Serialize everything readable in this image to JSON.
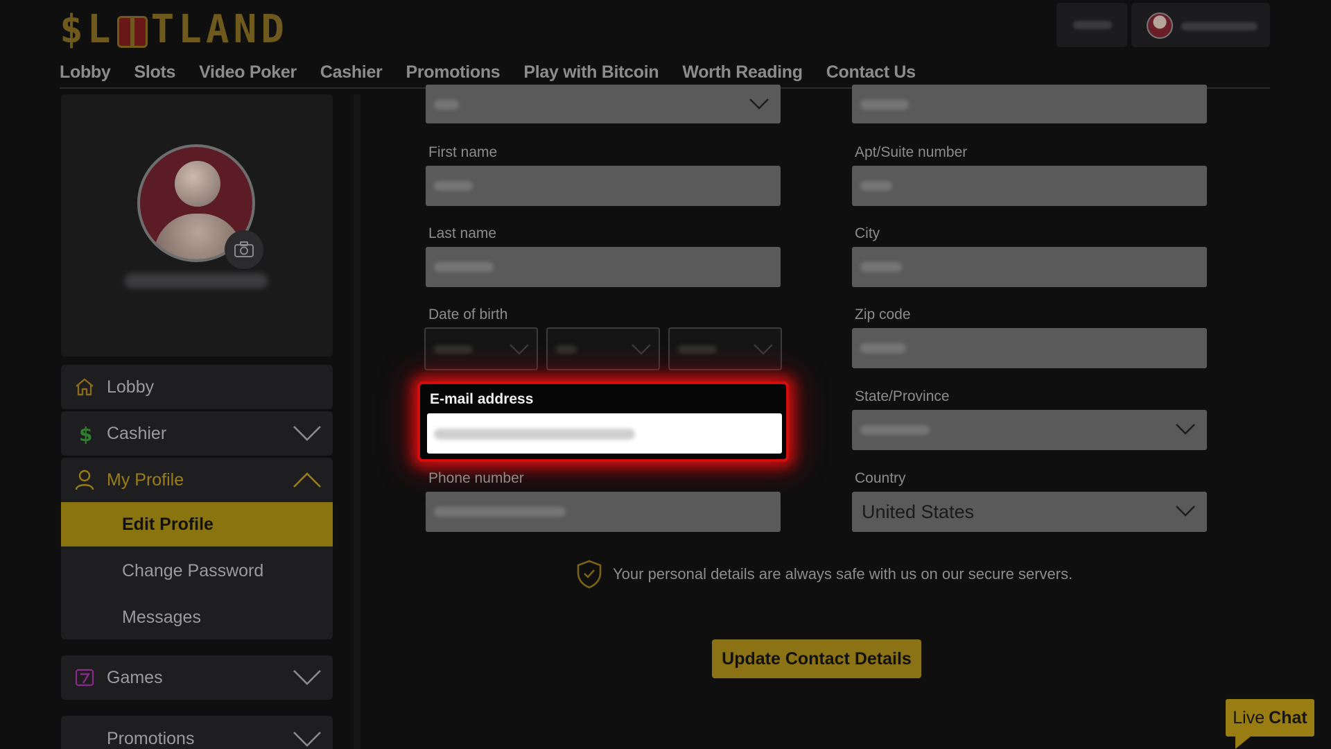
{
  "brand": {
    "logo_text_left": "$L",
    "logo_text_right": "TLAND"
  },
  "header": {
    "nav": [
      "Lobby",
      "Slots",
      "Video Poker",
      "Cashier",
      "Promotions",
      "Play with Bitcoin",
      "Worth Reading",
      "Contact Us"
    ]
  },
  "sidebar": {
    "items": [
      {
        "label": "Lobby"
      },
      {
        "label": "Cashier"
      },
      {
        "label": "My Profile"
      },
      {
        "label": "Games"
      },
      {
        "label": "Promotions"
      }
    ],
    "profile_submenu": [
      "Edit Profile",
      "Change Password",
      "Messages"
    ]
  },
  "form": {
    "labels": {
      "first_name": "First name",
      "last_name": "Last name",
      "dob": "Date of birth",
      "email": "E-mail address",
      "phone": "Phone number",
      "apt": "Apt/Suite number",
      "city": "City",
      "zip": "Zip code",
      "state": "State/Province",
      "country": "Country"
    },
    "country_value": "United States"
  },
  "security_note": "Your personal details are always safe with us on our secure servers.",
  "update_button": "Update Contact Details",
  "live_chat": {
    "light": "Live",
    "bold": "Chat"
  },
  "colors": {
    "accent_gold": "#8b7214",
    "highlight_red": "#d10d0d",
    "background": "#0f0f10"
  }
}
